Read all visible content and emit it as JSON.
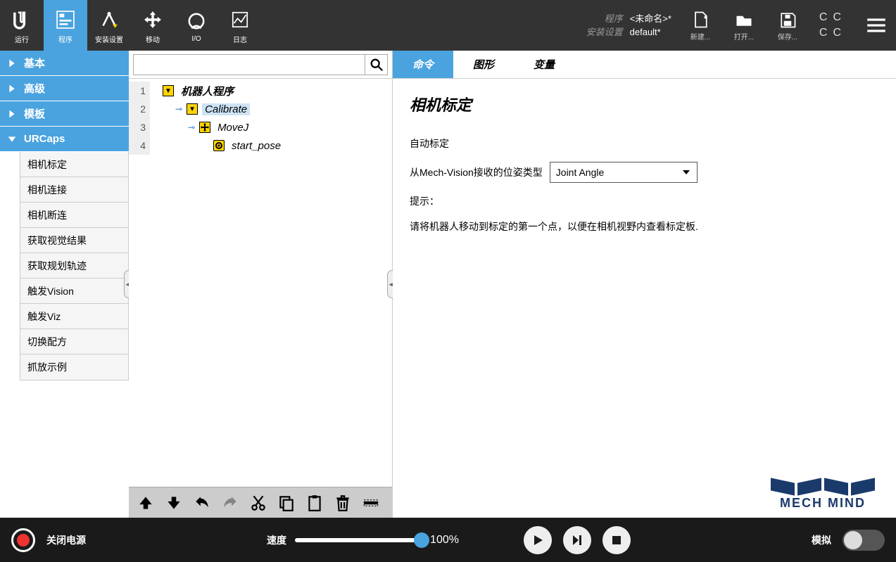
{
  "topnav": {
    "items": [
      {
        "label": "运行"
      },
      {
        "label": "程序"
      },
      {
        "label": "安装设置"
      },
      {
        "label": "移动"
      },
      {
        "label": "I/O"
      },
      {
        "label": "日志"
      }
    ]
  },
  "meta": {
    "program_key": "程序",
    "program_val": "<未命名>*",
    "install_key": "安装设置",
    "install_val": "default*"
  },
  "file_actions": [
    {
      "label": "新建..."
    },
    {
      "label": "打开..."
    },
    {
      "label": "保存..."
    }
  ],
  "sidebar": {
    "sections": [
      {
        "label": "基本",
        "open": false
      },
      {
        "label": "高级",
        "open": false
      },
      {
        "label": "模板",
        "open": false
      },
      {
        "label": "URCaps",
        "open": true
      }
    ],
    "urcaps_items": [
      "相机标定",
      "相机连接",
      "相机断连",
      "获取视觉结果",
      "获取规划轨迹",
      "触发Vision",
      "触发Viz",
      "切换配方",
      "抓放示例"
    ]
  },
  "tree": [
    {
      "n": "1",
      "label": "机器人程序",
      "indent": 0,
      "icon": "tri",
      "bold": true,
      "sel": false
    },
    {
      "n": "2",
      "label": "Calibrate",
      "indent": 1,
      "icon": "tri",
      "key": true,
      "sel": true
    },
    {
      "n": "3",
      "label": "MoveJ",
      "indent": 2,
      "icon": "move",
      "key": true,
      "sel": false
    },
    {
      "n": "4",
      "label": "start_pose",
      "indent": 3,
      "icon": "target",
      "sel": false
    }
  ],
  "tabs": [
    {
      "label": "命令",
      "active": true
    },
    {
      "label": "图形",
      "active": false
    },
    {
      "label": "变量",
      "active": false
    }
  ],
  "panel": {
    "title": "相机标定",
    "auto_label": "自动标定",
    "pose_label": "从Mech-Vision接收的位姿类型",
    "pose_value": "Joint Angle",
    "hint_label": "提示：",
    "hint_text": "请将机器人移动到标定的第一个点，以便在相机视野内查看标定板.",
    "logo_text": "MECH MIND"
  },
  "footer": {
    "power": "关闭电源",
    "speed_label": "速度",
    "speed_value": "100%",
    "sim_label": "模拟"
  }
}
